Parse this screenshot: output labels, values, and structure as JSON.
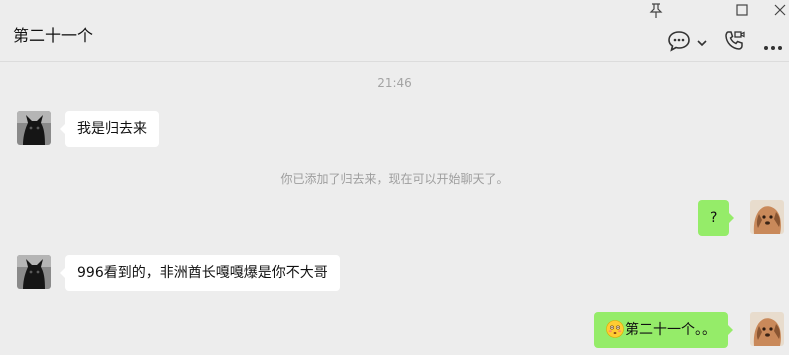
{
  "window": {
    "pin_icon": "pin-icon",
    "maximize_icon": "maximize-icon",
    "close_icon": "close-icon"
  },
  "header": {
    "title": "第二十一个",
    "chat_icon": "chat-bubble-icon",
    "dropdown_icon": "chevron-down-icon",
    "call_icon": "phone-video-icon",
    "more_icon": "more-dots-icon"
  },
  "messages": {
    "timestamp": "21:46",
    "incoming_1": "我是归去来",
    "system": "你已添加了归去来，现在可以开始聊天了。",
    "outgoing_1": "?",
    "incoming_2": "996看到的，非洲酋长嘎嘎爆是你不大哥",
    "outgoing_2": "第二十一个。。",
    "outgoing_2_emoji": "embarrassed-face-emoji"
  },
  "colors": {
    "background": "#ededed",
    "incoming_bubble": "#ffffff",
    "outgoing_bubble": "#95ec69",
    "timestamp_text": "#a3a3a3"
  }
}
